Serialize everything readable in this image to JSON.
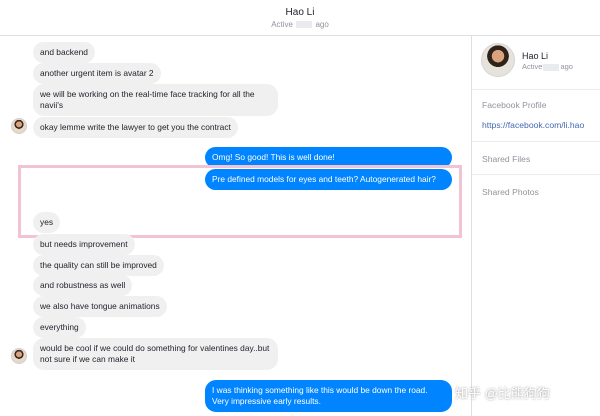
{
  "header": {
    "name": "Hao Li",
    "status_prefix": "Active",
    "status_suffix": "ago"
  },
  "messages": [
    {
      "side": "in",
      "text": "and backend"
    },
    {
      "side": "in",
      "text": "another urgent item is avatar 2"
    },
    {
      "side": "in",
      "text": "we will be working on the real-time face tracking for all the navii's"
    },
    {
      "side": "in",
      "text": "okay lemme write the lawyer to get you the contract"
    },
    {
      "side": "out",
      "text": "Omg! So good! This is well done!"
    },
    {
      "side": "out",
      "text": "Pre defined models for eyes and teeth? Autogenerated hair?"
    },
    {
      "side": "in",
      "text": "yes"
    },
    {
      "side": "in",
      "text": "but needs improvement"
    },
    {
      "side": "in",
      "text": "the quality can still be improved"
    },
    {
      "side": "in",
      "text": "and robustness as well"
    },
    {
      "side": "in",
      "text": "we also have tongue animations"
    },
    {
      "side": "in",
      "text": "everything"
    },
    {
      "side": "in",
      "text": "would be cool if we could do something for valentines day..but not sure if we can make it"
    },
    {
      "side": "out",
      "text": "I was thinking something like this would be down the road. Very impressive early results."
    }
  ],
  "sidebar": {
    "name": "Hao Li",
    "status_prefix": "Active",
    "status_suffix": "ago",
    "facebook_profile_label": "Facebook Profile",
    "facebook_profile_url": "https://facebook.com/li.hao",
    "shared_files_label": "Shared Files",
    "shared_photos_label": "Shared Photos"
  },
  "watermark": "知乎 @比熊狗狗",
  "colors": {
    "outgoing": "#0084ff",
    "incoming": "#f1f0f0",
    "highlight": "#f2c3d3",
    "link": "#4267b2"
  }
}
